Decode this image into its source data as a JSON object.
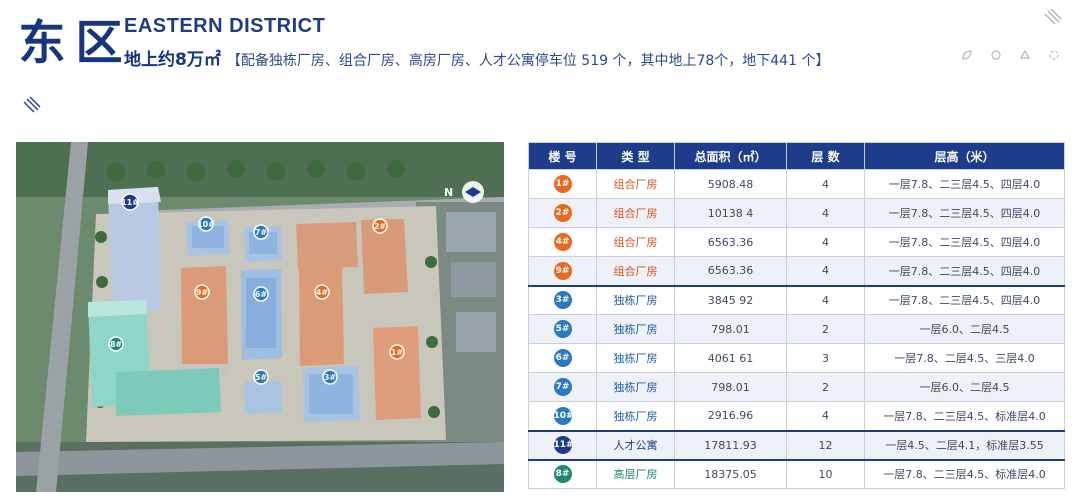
{
  "header": {
    "title_chars": [
      "东",
      "区"
    ],
    "title_en": "EASTERN DISTRICT",
    "area": "地上约8万㎡",
    "detail": "【配备独栋厂房、组合厂房、高房厂房、人才公寓停车位 519 个，其中地上78个，地下441 个】"
  },
  "colors": {
    "navy": "#1d3d8c",
    "orange": "#e86a1e",
    "blue": "#2a7ac2",
    "green": "#1a8a73"
  },
  "map": {
    "compass": "N",
    "pins": [
      "11#",
      "10#",
      "7#",
      "2#",
      "9#",
      "6#",
      "4#",
      "8#",
      "1#",
      "5#",
      "3#"
    ]
  },
  "table": {
    "headers": [
      "楼 号",
      "类 型",
      "总面积（㎡）",
      "层 数",
      "层高（米）"
    ],
    "rows": [
      {
        "id": "1#",
        "type": "组合厂房",
        "area": "5908.48",
        "floors": "4",
        "height": "一层7.8、二三层4.5、四层4.0",
        "color": "orange"
      },
      {
        "id": "2#",
        "type": "组合厂房",
        "area": "10138 4",
        "floors": "4",
        "height": "一层7.8、二三层4.5、四层4.0",
        "color": "orange"
      },
      {
        "id": "4#",
        "type": "组合厂房",
        "area": "6563.36",
        "floors": "4",
        "height": "一层7.8、二三层4.5、四层4.0",
        "color": "orange"
      },
      {
        "id": "9#",
        "type": "组合厂房",
        "area": "6563.36",
        "floors": "4",
        "height": "一层7.8、二三层4.5、四层4.0",
        "color": "orange"
      },
      {
        "id": "3#",
        "type": "独栋厂房",
        "area": "3845 92",
        "floors": "4",
        "height": "一层7.8、二三层4.5、四层4.0",
        "color": "blue"
      },
      {
        "id": "5#",
        "type": "独栋厂房",
        "area": "798.01",
        "floors": "2",
        "height": "一层6.0、二层4.5",
        "color": "blue"
      },
      {
        "id": "6#",
        "type": "独栋厂房",
        "area": "4061 61",
        "floors": "3",
        "height": "一层7.8、二层4.5、三层4.0",
        "color": "blue"
      },
      {
        "id": "7#",
        "type": "独栋厂房",
        "area": "798.01",
        "floors": "2",
        "height": "一层6.0、二层4.5",
        "color": "blue"
      },
      {
        "id": "10#",
        "type": "独栋厂房",
        "area": "2916.96",
        "floors": "4",
        "height": "一层7.8、二三层4.5、标准层4.0",
        "color": "blue"
      },
      {
        "id": "11#",
        "type": "人才公寓",
        "area": "17811.93",
        "floors": "12",
        "height": "一层4.5、二层4.1，标准层3.55",
        "color": "navy"
      },
      {
        "id": "8#",
        "type": "高层厂房",
        "area": "18375.05",
        "floors": "10",
        "height": "一层7.8、二三层4.5、标准层4.0",
        "color": "green"
      }
    ]
  }
}
